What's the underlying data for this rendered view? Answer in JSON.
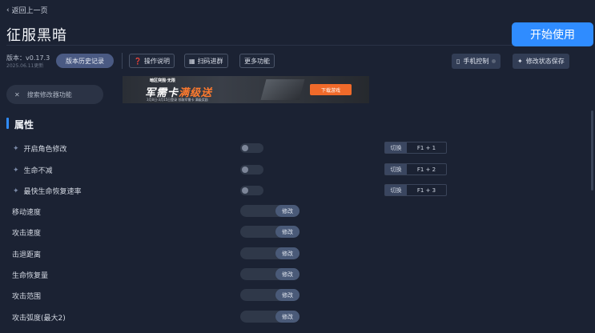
{
  "nav": {
    "back_label": "返回上一页"
  },
  "game": {
    "title": "征服黑暗"
  },
  "header": {
    "start_label": "开始使用",
    "version_label": "版本：v0.17.3",
    "update_date": "2025.06.11更新",
    "history_label": "版本历史记录",
    "tools": [
      {
        "label": "操作说明",
        "icon": "question-icon"
      },
      {
        "label": "扫码进群",
        "icon": "qrcode-icon"
      },
      {
        "label": "更多功能",
        "icon": ""
      }
    ],
    "phone_control_label": "手机控制",
    "save_state_label": "修改状态保存"
  },
  "search": {
    "placeholder": "搜索修改器功能"
  },
  "banner": {
    "small_text": "暗区突围·无限",
    "big_text_a": "军需卡",
    "big_text_b": "满级送",
    "tiny_text": "3月8日-3月15日登录 领取军需卡 满级奖励",
    "button_label": "下载游戏"
  },
  "section": {
    "title": "属性"
  },
  "toggles": [
    {
      "label": "开启角色修改",
      "hotkey_action": "切换",
      "hotkey": "F1 + 1",
      "on": false
    },
    {
      "label": "生命不减",
      "hotkey_action": "切换",
      "hotkey": "F1 + 2",
      "on": false
    },
    {
      "label": "最快生命恢复速率",
      "hotkey_action": "切换",
      "hotkey": "F1 + 3",
      "on": false
    }
  ],
  "modifiers": [
    {
      "label": "移动速度",
      "button": "修改"
    },
    {
      "label": "攻击速度",
      "button": "修改"
    },
    {
      "label": "击退距离",
      "button": "修改"
    },
    {
      "label": "生命恢复量",
      "button": "修改"
    },
    {
      "label": "攻击范围",
      "button": "修改"
    },
    {
      "label": "攻击弧度(最大2)",
      "button": "修改"
    }
  ],
  "colors": {
    "accent": "#2f8cff",
    "background": "#1b2233"
  }
}
